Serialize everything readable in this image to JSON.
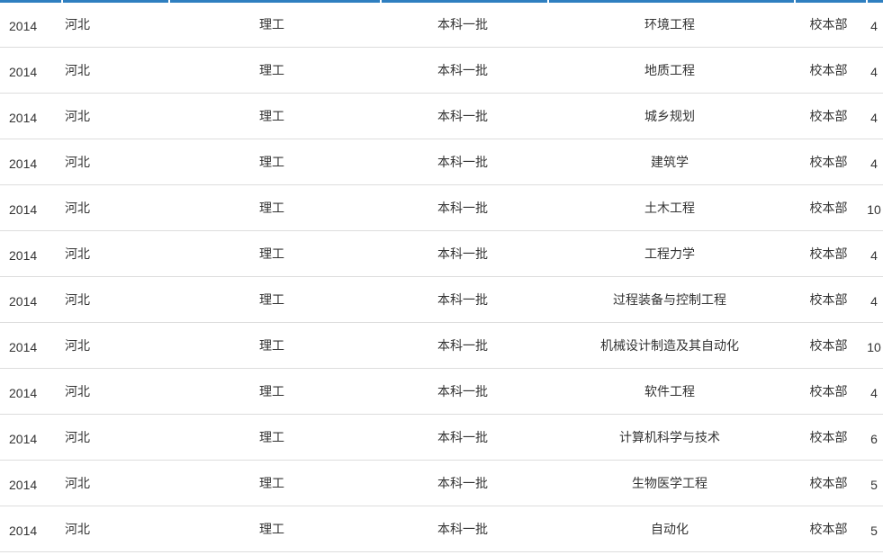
{
  "rows": [
    {
      "year": "2014",
      "province": "河北",
      "category": "理工",
      "batch": "本科一批",
      "major": "环境工程",
      "campus": "校本部",
      "count": "4"
    },
    {
      "year": "2014",
      "province": "河北",
      "category": "理工",
      "batch": "本科一批",
      "major": "地质工程",
      "campus": "校本部",
      "count": "4"
    },
    {
      "year": "2014",
      "province": "河北",
      "category": "理工",
      "batch": "本科一批",
      "major": "城乡规划",
      "campus": "校本部",
      "count": "4"
    },
    {
      "year": "2014",
      "province": "河北",
      "category": "理工",
      "batch": "本科一批",
      "major": "建筑学",
      "campus": "校本部",
      "count": "4"
    },
    {
      "year": "2014",
      "province": "河北",
      "category": "理工",
      "batch": "本科一批",
      "major": "土木工程",
      "campus": "校本部",
      "count": "10"
    },
    {
      "year": "2014",
      "province": "河北",
      "category": "理工",
      "batch": "本科一批",
      "major": "工程力学",
      "campus": "校本部",
      "count": "4"
    },
    {
      "year": "2014",
      "province": "河北",
      "category": "理工",
      "batch": "本科一批",
      "major": "过程装备与控制工程",
      "campus": "校本部",
      "count": "4"
    },
    {
      "year": "2014",
      "province": "河北",
      "category": "理工",
      "batch": "本科一批",
      "major": "机械设计制造及其自动化",
      "campus": "校本部",
      "count": "10"
    },
    {
      "year": "2014",
      "province": "河北",
      "category": "理工",
      "batch": "本科一批",
      "major": "软件工程",
      "campus": "校本部",
      "count": "4"
    },
    {
      "year": "2014",
      "province": "河北",
      "category": "理工",
      "batch": "本科一批",
      "major": "计算机科学与技术",
      "campus": "校本部",
      "count": "6"
    },
    {
      "year": "2014",
      "province": "河北",
      "category": "理工",
      "batch": "本科一批",
      "major": "生物医学工程",
      "campus": "校本部",
      "count": "5"
    },
    {
      "year": "2014",
      "province": "河北",
      "category": "理工",
      "batch": "本科一批",
      "major": "自动化",
      "campus": "校本部",
      "count": "5"
    }
  ],
  "colors": {
    "header_accent": "#2f7fc0",
    "row_divider": "#dddddd",
    "text": "#333333"
  }
}
